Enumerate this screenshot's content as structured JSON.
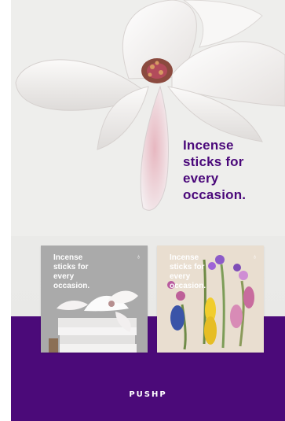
{
  "poster": {
    "headline_lines": [
      "Incense",
      "sticks for",
      "every",
      "occasion."
    ],
    "logo": "PUSHP"
  },
  "cards": [
    {
      "lines": [
        "Incense",
        "sticks for",
        "every",
        "occasion."
      ],
      "mark": "♁"
    },
    {
      "lines": [
        "Incense",
        "sticks for",
        "every",
        "occasion."
      ],
      "mark": "♁"
    }
  ],
  "colors": {
    "brand_purple": "#4b0a79",
    "text_purple": "#4a087a",
    "background": "#ededeb"
  }
}
